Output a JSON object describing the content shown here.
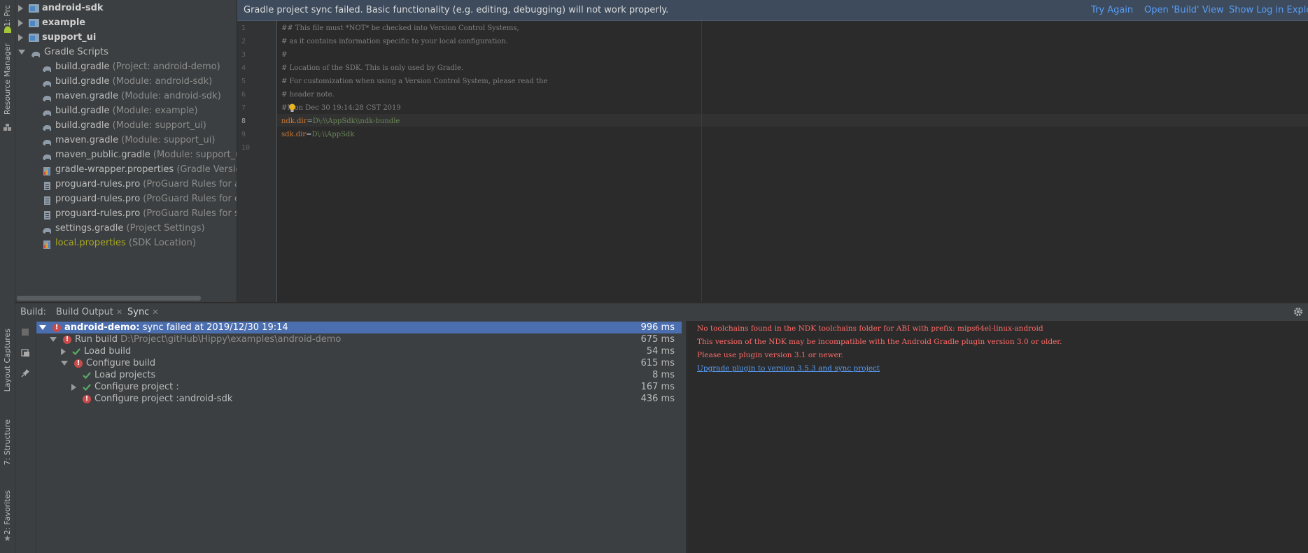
{
  "left_strip": {
    "project_tab": "1: Project",
    "resource_tab": "Resource Manager",
    "layout_tab": "Layout Captures",
    "structure_tab": "7: Structure",
    "favorites_tab": "2: Favorites"
  },
  "project_tree": [
    {
      "name": "android-sdk",
      "kind": "module",
      "expanded": false,
      "bold": true
    },
    {
      "name": "example",
      "kind": "module",
      "expanded": false,
      "bold": true
    },
    {
      "name": "support_ui",
      "kind": "module",
      "expanded": false,
      "bold": true
    },
    {
      "name": "Gradle Scripts",
      "kind": "group",
      "expanded": true
    },
    {
      "name": "build.gradle",
      "note": "(Project: android-demo)"
    },
    {
      "name": "build.gradle",
      "note": "(Module: android-sdk)"
    },
    {
      "name": "maven.gradle",
      "note": "(Module: android-sdk)"
    },
    {
      "name": "build.gradle",
      "note": "(Module: example)"
    },
    {
      "name": "build.gradle",
      "note": "(Module: support_ui)"
    },
    {
      "name": "maven.gradle",
      "note": "(Module: support_ui)"
    },
    {
      "name": "maven_public.gradle",
      "note": "(Module: support_ui)"
    },
    {
      "name": "gradle-wrapper.properties",
      "note": "(Gradle Version)"
    },
    {
      "name": "proguard-rules.pro",
      "note": "(ProGuard Rules for and"
    },
    {
      "name": "proguard-rules.pro",
      "note": "(ProGuard Rules for exa"
    },
    {
      "name": "proguard-rules.pro",
      "note": "(ProGuard Rules for sup"
    },
    {
      "name": "settings.gradle",
      "note": "(Project Settings)"
    },
    {
      "name": "local.properties",
      "note": "(SDK Location)",
      "highlight": "#a7a722"
    }
  ],
  "banner": {
    "message": "Gradle project sync failed. Basic functionality (e.g. editing, debugging) will not work properly.",
    "try_again": "Try Again",
    "open_build": "Open 'Build' View",
    "show_log": "Show Log in Explor"
  },
  "editor": {
    "line_numbers": [
      "1",
      "2",
      "3",
      "4",
      "5",
      "6",
      "7",
      "8",
      "9",
      "10"
    ],
    "lines": [
      "## This file must *NOT* be checked into Version Control Systems,",
      "# as it contains information specific to your local configuration.",
      "#",
      "# Location of the SDK. This is only used by Gradle.",
      "# For customization when using a Version Control System, please read the",
      "# header note.",
      "#Mon Dec 30 19:14:28 CST 2019"
    ],
    "ndk_key": "ndk.dir",
    "ndk_value": "D\\:\\\\AppSdk\\\\ndk-bundle",
    "sdk_key": "sdk.dir",
    "sdk_value": "D\\:\\\\AppSdk",
    "eq": "="
  },
  "build": {
    "label": "Build:",
    "tab_output": "Build Output",
    "tab_sync": "Sync",
    "rows": [
      {
        "label": "android-demo:",
        "detail": "sync failed at 2019/12/30 19:14",
        "time": "996 ms",
        "status": "error",
        "selected": true
      },
      {
        "label": "Run build",
        "detail": "D:\\Project\\gitHub\\Hippy\\examples\\android-demo",
        "time": "675 ms",
        "status": "error"
      },
      {
        "label": "Load build",
        "time": "54 ms",
        "status": "ok"
      },
      {
        "label": "Configure build",
        "time": "615 ms",
        "status": "error"
      },
      {
        "label": "Load projects",
        "time": "8 ms",
        "status": "ok"
      },
      {
        "label": "Configure project :",
        "time": "167 ms",
        "status": "ok"
      },
      {
        "label": "Configure project :android-sdk",
        "time": "436 ms",
        "status": "error"
      }
    ],
    "console": [
      "No toolchains found in the NDK toolchains folder for ABI with prefix: mips64el-linux-android",
      "This version of the NDK may be incompatible with the Android Gradle plugin version 3.0 or older.",
      "Please use plugin version 3.1 or newer."
    ],
    "console_link": "Upgrade plugin to version 3.5.3 and sync project"
  }
}
